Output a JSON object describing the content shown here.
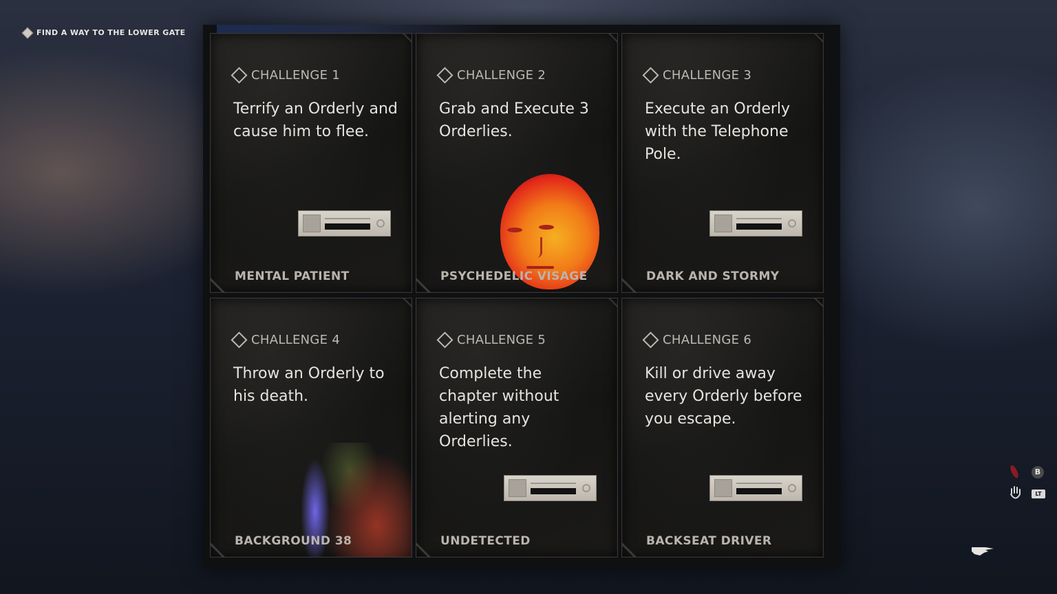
{
  "objective": {
    "text": "FIND A WAY TO THE LOWER GATE",
    "icon": "diamond-icon"
  },
  "challenges": [
    {
      "header": "CHALLENGE 1",
      "description": "Terrify an Orderly and cause him to flee.",
      "reward": "MENTAL PATIENT",
      "reward_type": "ticket"
    },
    {
      "header": "CHALLENGE 2",
      "description": "Grab and Execute 3 Orderlies.",
      "reward": "PSYCHEDELIC VISAGE",
      "reward_type": "face"
    },
    {
      "header": "CHALLENGE 3",
      "description": "Execute an Orderly with the Telephone Pole.",
      "reward": "DARK AND STORMY",
      "reward_type": "ticket"
    },
    {
      "header": "CHALLENGE 4",
      "description": "Throw an Orderly to his death.",
      "reward": "BACKGROUND 38",
      "reward_type": "background"
    },
    {
      "header": "CHALLENGE 5",
      "description": "Complete the chapter without alerting any Orderlies.",
      "reward": "UNDETECTED",
      "reward_type": "ticket"
    },
    {
      "header": "CHALLENGE 6",
      "description": "Kill or drive away every Orderly before you escape.",
      "reward": "BACKSEAT DRIVER",
      "reward_type": "ticket"
    }
  ],
  "hud": {
    "button_b": "B",
    "button_lt": "LT",
    "icons": [
      "red-mark-icon",
      "grab-hand-icon",
      "pointing-hand-icon"
    ]
  }
}
